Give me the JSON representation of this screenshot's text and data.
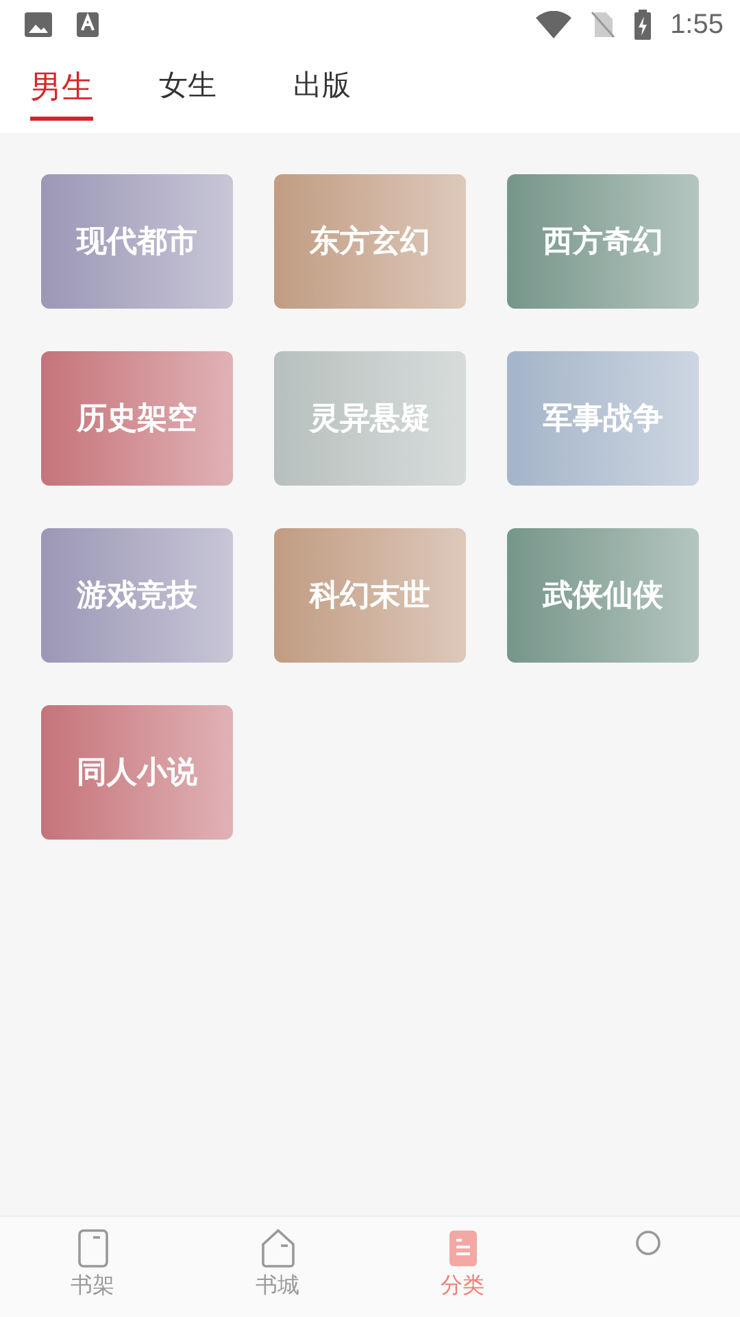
{
  "status_bar": {
    "time": "1:55"
  },
  "tabs": [
    {
      "label": "男生",
      "selected": true
    },
    {
      "label": "女生",
      "selected": false
    },
    {
      "label": "出版",
      "selected": false
    }
  ],
  "categories": [
    {
      "label": "现代都市",
      "color": "#9b97b6"
    },
    {
      "label": "东方玄幻",
      "color": "#c19c82"
    },
    {
      "label": "西方奇幻",
      "color": "#76968a"
    },
    {
      "label": "历史架空",
      "color": "#c5737a"
    },
    {
      "label": "灵异悬疑",
      "color": "#b7c0be"
    },
    {
      "label": "军事战争",
      "color": "#a4b4c9"
    },
    {
      "label": "游戏竞技",
      "color": "#9b97b6"
    },
    {
      "label": "科幻末世",
      "color": "#c19c82"
    },
    {
      "label": "武侠仙侠",
      "color": "#76968a"
    },
    {
      "label": "同人小说",
      "color": "#c5737a"
    }
  ],
  "bottom_nav": [
    {
      "label": "书架",
      "kind": "shelf",
      "selected": false
    },
    {
      "label": "书城",
      "kind": "store",
      "selected": false
    },
    {
      "label": "分类",
      "kind": "category",
      "selected": true
    },
    {
      "kind": "profile",
      "selected": false
    }
  ]
}
